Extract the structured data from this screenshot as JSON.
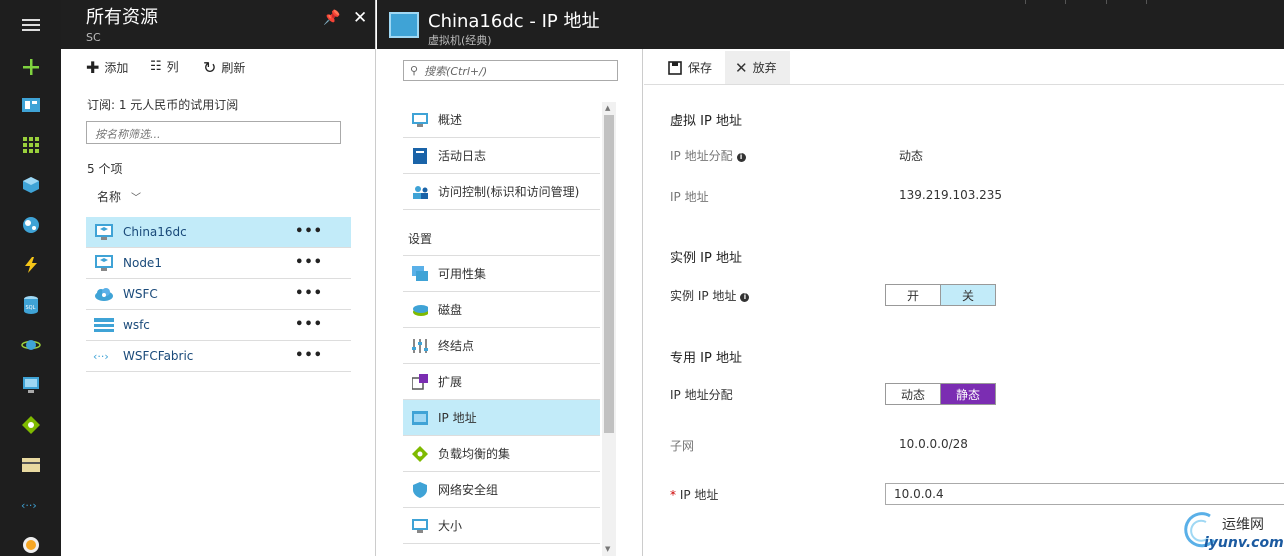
{
  "colors": {
    "dark_chrome": "#1f1f1f",
    "selection": "#c2ebf9",
    "static_toggle": "#7b2db2"
  },
  "rail": {
    "icons": [
      "menu-icon",
      "create-icon",
      "dashboard-icon",
      "all-resources-icon",
      "resource-group-icon",
      "app-service-icon",
      "function-app-icon",
      "sql-icon",
      "cosmos-icon",
      "virtual-machine-icon",
      "load-balancer-icon",
      "storage-icon",
      "virtual-network-icon",
      "advisor-icon"
    ]
  },
  "resources": {
    "title": "所有资源",
    "subtitle": "SC",
    "commands": {
      "add": "添加",
      "columns": "列",
      "refresh": "刷新"
    },
    "subscription": "订阅: 1 元人民币的试用订阅",
    "filter_placeholder": "按名称筛选...",
    "count": "5 个项",
    "column_name": "名称",
    "items": [
      {
        "name": "China16dc",
        "icon": "vm-icon",
        "selected": true
      },
      {
        "name": "Node1",
        "icon": "vm-icon",
        "selected": false
      },
      {
        "name": "WSFC",
        "icon": "cloud-service-icon",
        "selected": false
      },
      {
        "name": "wsfc",
        "icon": "storage-account-icon",
        "selected": false
      },
      {
        "name": "WSFCFabric",
        "icon": "virtual-network-icon",
        "selected": false
      }
    ],
    "more": "•••"
  },
  "vm": {
    "title": "China16dc - IP 地址",
    "subtitle": "虚拟机(经典)",
    "search_placeholder": "搜索(Ctrl+/)",
    "menu_top": [
      {
        "label": "概述",
        "icon": "overview-icon"
      },
      {
        "label": "活动日志",
        "icon": "activity-log-icon"
      },
      {
        "label": "访问控制(标识和访问管理)",
        "icon": "access-control-icon"
      }
    ],
    "settings_label": "设置",
    "menu_settings": [
      {
        "label": "可用性集",
        "icon": "availability-set-icon",
        "selected": false
      },
      {
        "label": "磁盘",
        "icon": "disk-icon",
        "selected": false
      },
      {
        "label": "终结点",
        "icon": "endpoints-icon",
        "selected": false
      },
      {
        "label": "扩展",
        "icon": "extensions-icon",
        "selected": false
      },
      {
        "label": "IP 地址",
        "icon": "ip-address-icon",
        "selected": true
      },
      {
        "label": "负载均衡的集",
        "icon": "load-balanced-set-icon",
        "selected": false
      },
      {
        "label": "网络安全组",
        "icon": "network-security-group-icon",
        "selected": false
      },
      {
        "label": "大小",
        "icon": "size-icon",
        "selected": false
      }
    ]
  },
  "ip": {
    "save": "保存",
    "discard": "放弃",
    "virtual_heading": "虚拟 IP 地址",
    "vip_assignment_label": "IP 地址分配",
    "vip_assignment_value": "动态",
    "vip_address_label": "IP 地址",
    "vip_address_value": "139.219.103.235",
    "instance_heading": "实例 IP 地址",
    "instance_label": "实例 IP 地址",
    "instance_toggle": {
      "off": "开",
      "on": "关",
      "selected": "关"
    },
    "private_heading": "专用 IP 地址",
    "private_assignment_label": "IP 地址分配",
    "private_toggle": {
      "dynamic": "动态",
      "static": "静态",
      "selected": "静态"
    },
    "subnet_label": "子网",
    "subnet_value": "10.0.0.0/28",
    "ip_label": "IP 地址",
    "ip_required": "*",
    "ip_value": "10.0.0.4"
  },
  "watermark": {
    "line1": "运维网",
    "line2": "iyunv.com"
  }
}
